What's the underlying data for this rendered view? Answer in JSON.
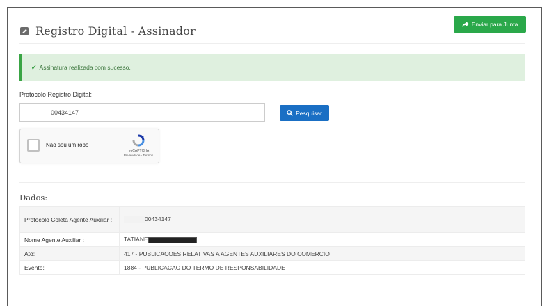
{
  "header": {
    "title": "Registro Digital - Assinador",
    "send_button_label": "Enviar para Junta",
    "send_icon": "share-arrow-icon"
  },
  "alert": {
    "message": "Assinatura realizada com sucesso.",
    "icon": "check-icon",
    "color": "#3c763d"
  },
  "form": {
    "protocol_label": "Protocolo Registro Digital:",
    "protocol_value": "00434147",
    "search_button_label": "Pesquisar",
    "search_icon": "search-icon"
  },
  "captcha": {
    "label": "Não sou um robô",
    "brand": "reCAPTCHA",
    "links": "Privacidade - Termos"
  },
  "dados": {
    "title": "Dados:",
    "rows": [
      {
        "key": "Protocolo Coleta Agente Auxiliar :",
        "value": "00434147"
      },
      {
        "key": "Nome Agente Auxiliar :",
        "value": "TATIANE"
      },
      {
        "key": "Ato:",
        "value": "417 - PUBLICACOES RELATIVAS A AGENTES AUXILIARES DO COMERCIO"
      },
      {
        "key": "Evento:",
        "value": "1884 - PUBLICACAO DO TERMO DE RESPONSABILIDADE"
      }
    ]
  },
  "colors": {
    "success_green": "#2aa84a",
    "primary_blue": "#1a6fc4",
    "alert_bg": "#dff0df"
  }
}
